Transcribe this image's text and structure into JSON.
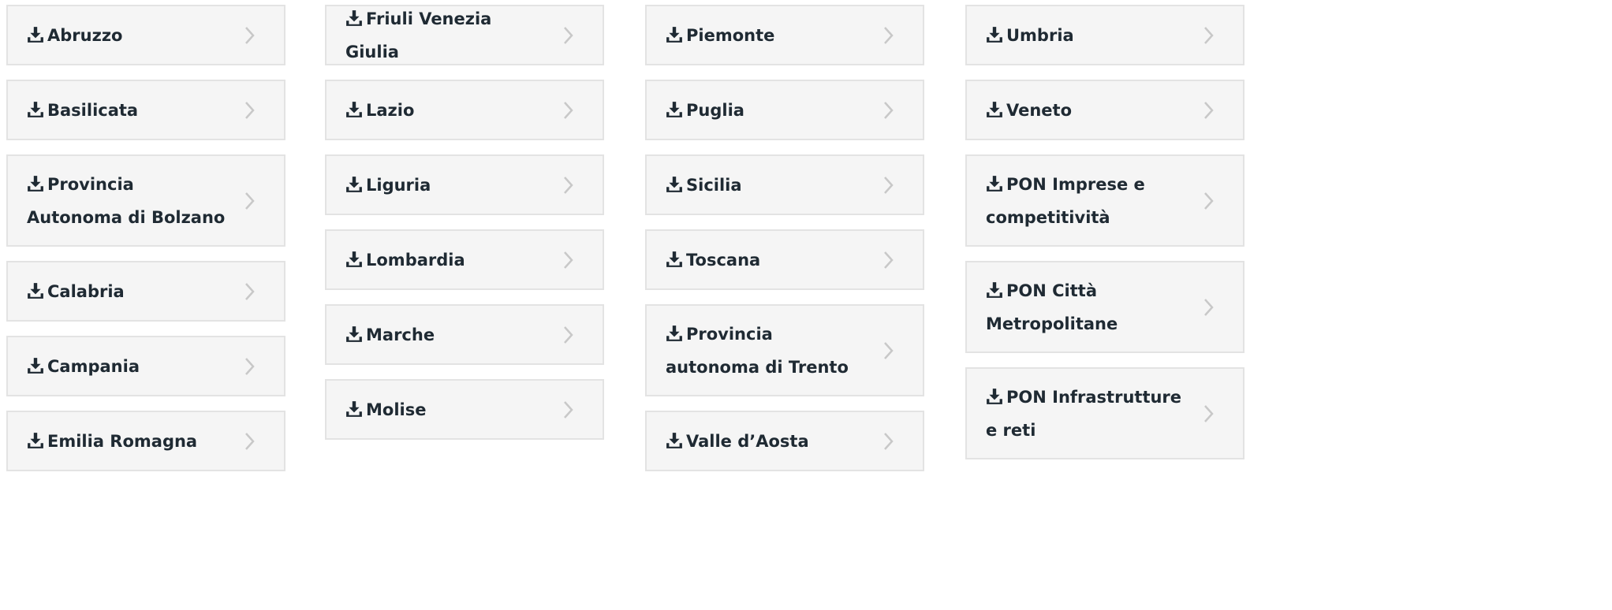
{
  "icons": {
    "download": "download-icon",
    "chevron": "chevron-right-icon"
  },
  "colors": {
    "item_bg": "#f5f5f5",
    "item_border": "#e3e3e3",
    "text": "#1f2a33",
    "icon": "#1f2a33",
    "chevron": "#c8c8c8"
  },
  "columns": [
    {
      "items": [
        {
          "label": "Abruzzo"
        },
        {
          "label": "Basilicata"
        },
        {
          "label": "Provincia Autonoma di Bolzano"
        },
        {
          "label": "Calabria"
        },
        {
          "label": "Campania"
        },
        {
          "label": "Emilia Romagna"
        }
      ]
    },
    {
      "items": [
        {
          "label": "Friuli Venezia Giulia"
        },
        {
          "label": "Lazio"
        },
        {
          "label": "Liguria"
        },
        {
          "label": "Lombardia"
        },
        {
          "label": "Marche"
        },
        {
          "label": "Molise"
        }
      ]
    },
    {
      "items": [
        {
          "label": "Piemonte"
        },
        {
          "label": "Puglia"
        },
        {
          "label": "Sicilia"
        },
        {
          "label": "Toscana"
        },
        {
          "label": "Provincia autonoma di Trento"
        },
        {
          "label": "Valle d’Aosta"
        }
      ]
    },
    {
      "items": [
        {
          "label": "Umbria"
        },
        {
          "label": "Veneto"
        },
        {
          "label": "PON Imprese e competitività"
        },
        {
          "label": "PON Città Metropolitane"
        },
        {
          "label": "PON Infrastrutture e reti"
        }
      ]
    }
  ]
}
